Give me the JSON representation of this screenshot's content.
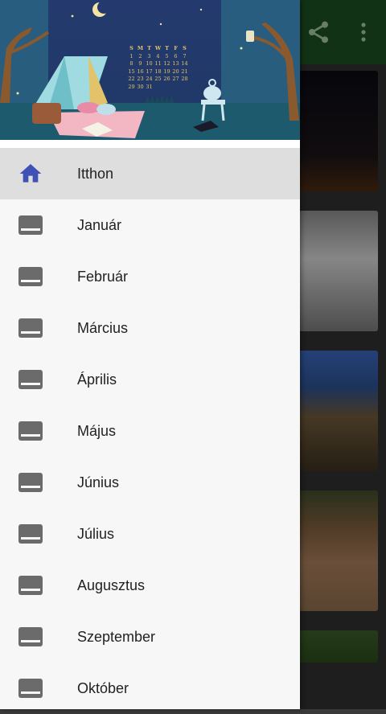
{
  "colors": {
    "accent": "#3f51b5",
    "icon_gray": "#6b6b6b",
    "appbar_green": "#1b4d1f"
  },
  "appbar": {
    "icons": [
      "share-icon",
      "more-vert-icon"
    ]
  },
  "header": {
    "calendar": {
      "weekdays": [
        "S",
        "M",
        "T",
        "W",
        "T",
        "F",
        "S"
      ],
      "rows": [
        [
          "1",
          "2",
          "3",
          "4",
          "5",
          "6",
          "7"
        ],
        [
          "8",
          "9",
          "10",
          "11",
          "12",
          "13",
          "14"
        ],
        [
          "15",
          "16",
          "17",
          "18",
          "19",
          "20",
          "21"
        ],
        [
          "22",
          "23",
          "24",
          "25",
          "26",
          "27",
          "28"
        ],
        [
          "29",
          "30",
          "31",
          "",
          "",
          "",
          ""
        ]
      ]
    }
  },
  "menu": {
    "items": [
      {
        "label": "Itthon",
        "icon": "home-icon",
        "active": true
      },
      {
        "label": "Január",
        "icon": "calendar-icon"
      },
      {
        "label": "Február",
        "icon": "calendar-icon"
      },
      {
        "label": "Március",
        "icon": "calendar-icon"
      },
      {
        "label": "Április",
        "icon": "calendar-icon"
      },
      {
        "label": "Május",
        "icon": "calendar-icon"
      },
      {
        "label": "Június",
        "icon": "calendar-icon"
      },
      {
        "label": "Július",
        "icon": "calendar-icon"
      },
      {
        "label": "Augusztus",
        "icon": "calendar-icon"
      },
      {
        "label": "Szeptember",
        "icon": "calendar-icon"
      },
      {
        "label": "Október",
        "icon": "calendar-icon"
      }
    ]
  }
}
